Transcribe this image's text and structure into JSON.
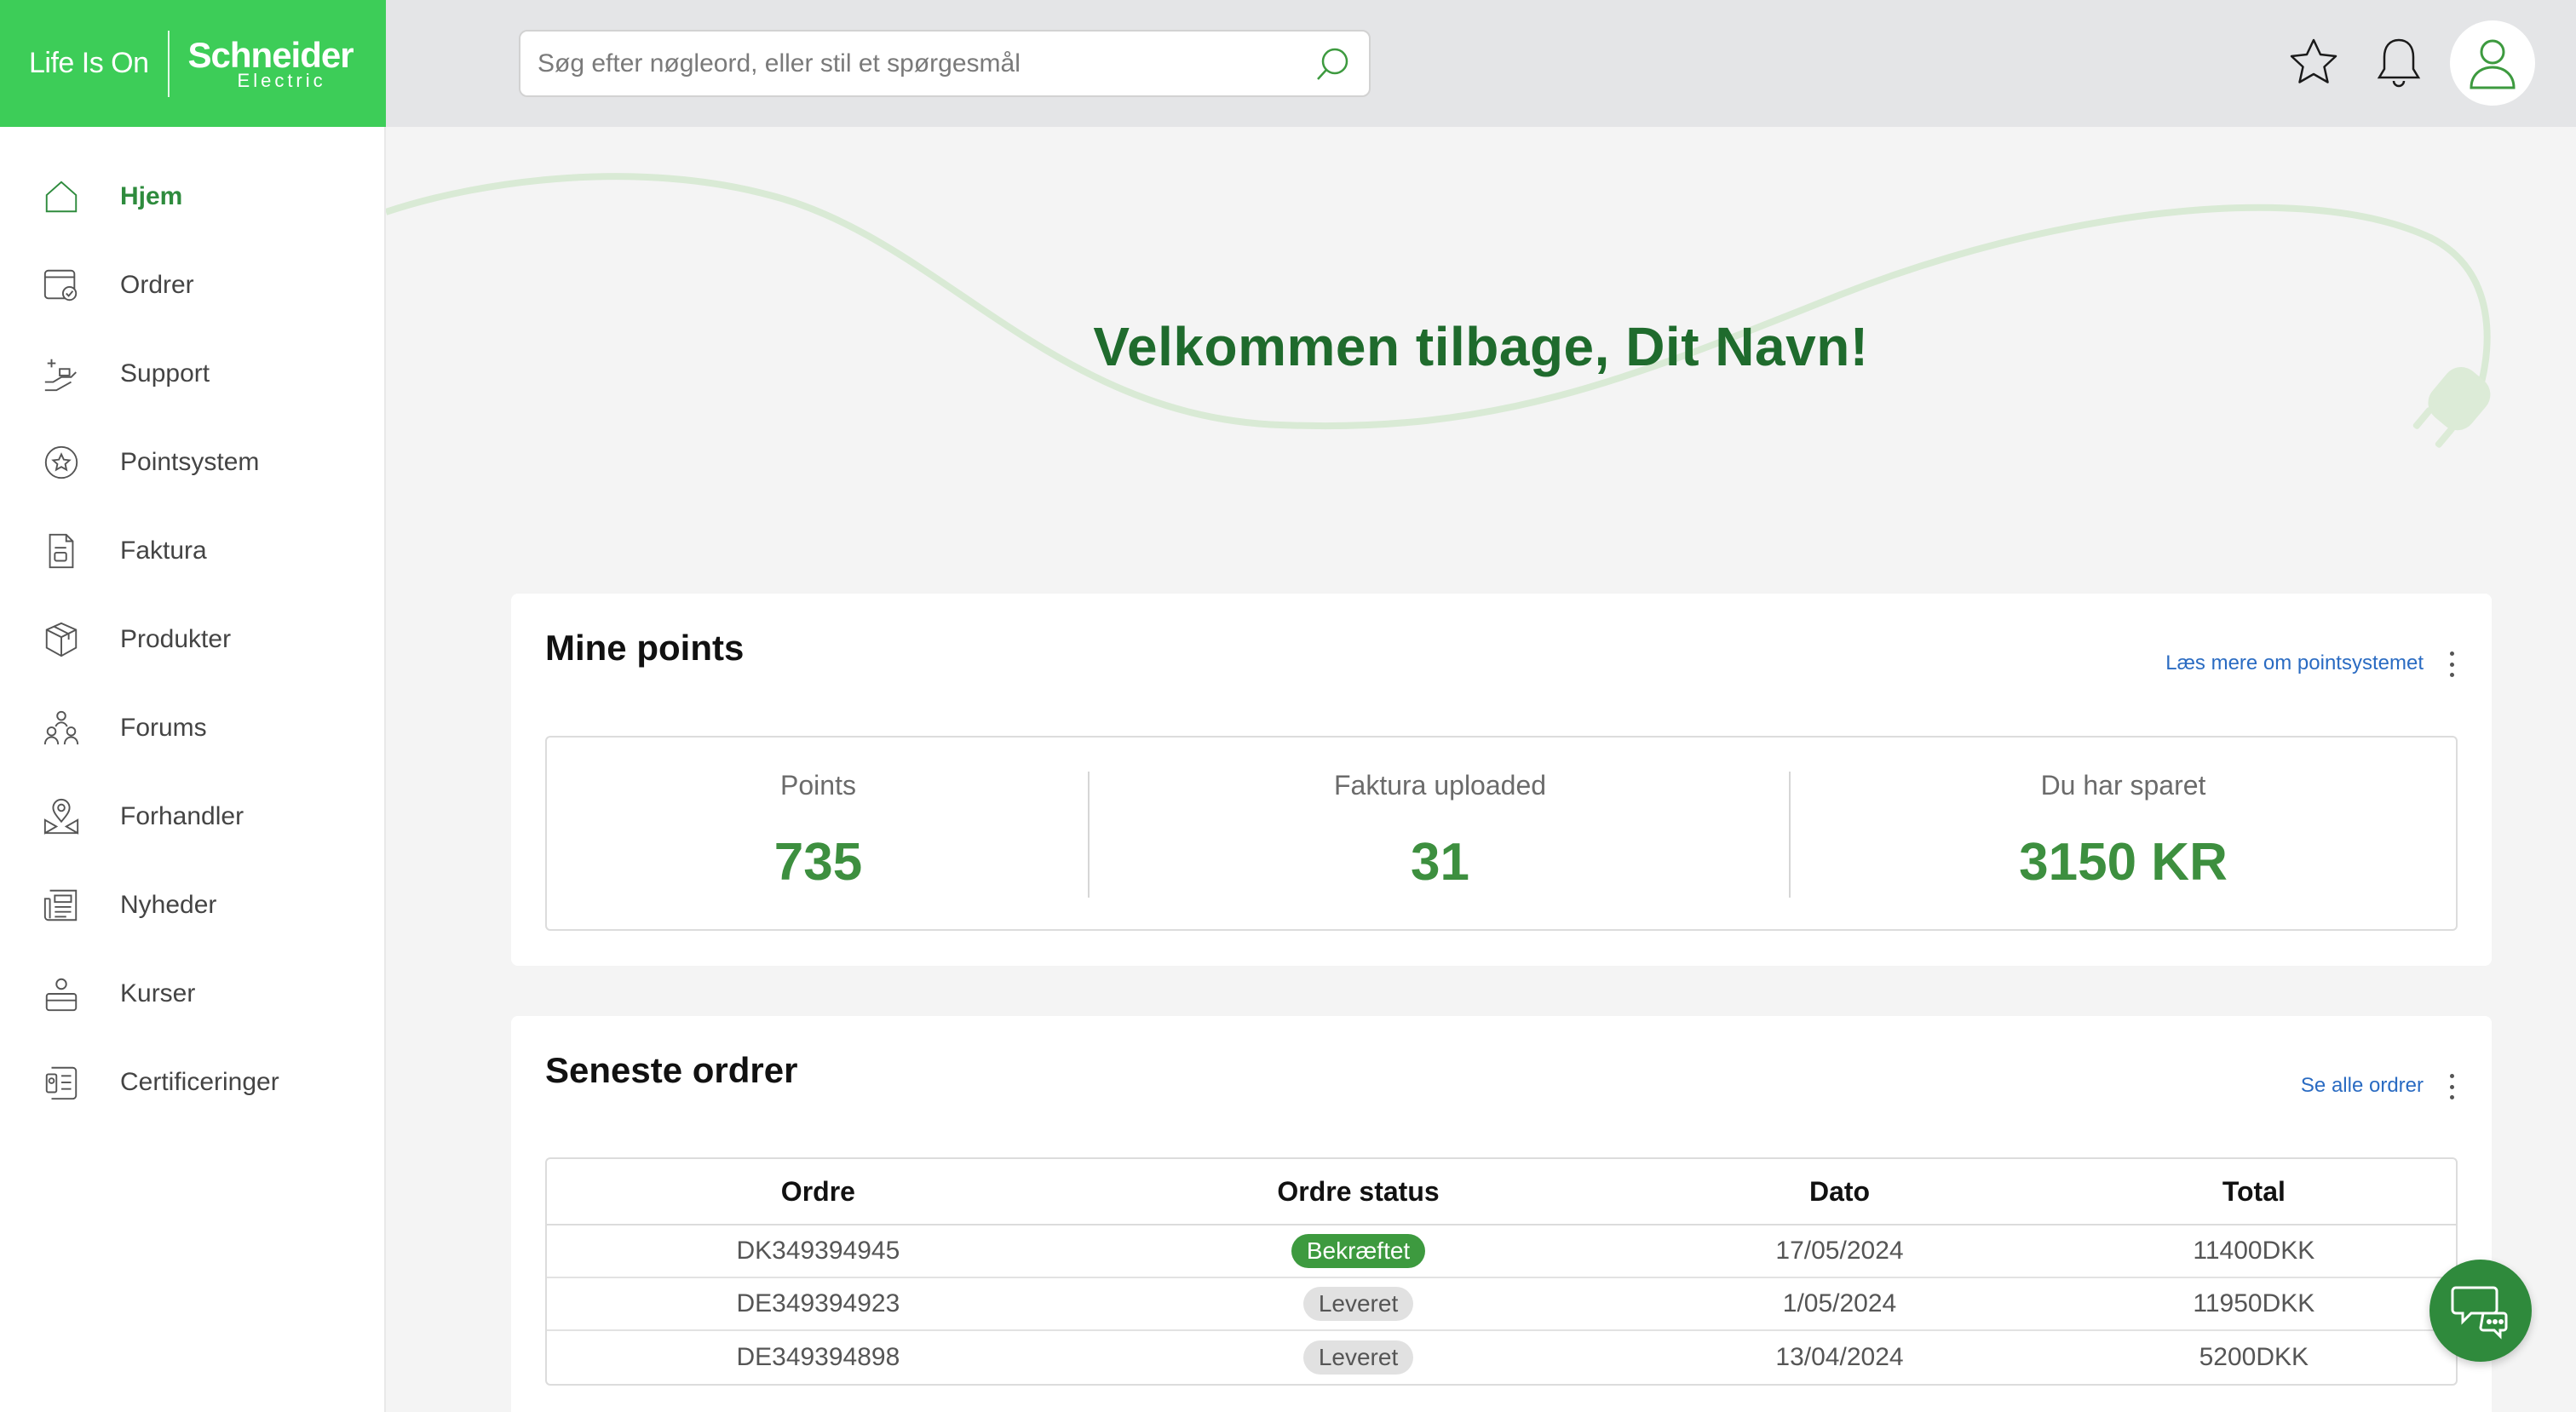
{
  "brand": {
    "tagline": "Life Is On",
    "name": "Schneider",
    "sub": "Electric"
  },
  "colors": {
    "brand_green": "#3dcd58",
    "dark_green": "#1f6b2d",
    "value_green": "#3d8f3f",
    "link_blue": "#2a6bc2"
  },
  "sidebar": {
    "items": [
      {
        "label": "Hjem",
        "icon": "home-icon",
        "active": true
      },
      {
        "label": "Ordrer",
        "icon": "orders-icon"
      },
      {
        "label": "Support",
        "icon": "support-icon"
      },
      {
        "label": "Pointsystem",
        "icon": "points-star-icon"
      },
      {
        "label": "Faktura",
        "icon": "invoice-icon"
      },
      {
        "label": "Produkter",
        "icon": "box-icon"
      },
      {
        "label": "Forums",
        "icon": "forum-people-icon"
      },
      {
        "label": "Forhandler",
        "icon": "dealer-location-icon"
      },
      {
        "label": "Nyheder",
        "icon": "newspaper-icon"
      },
      {
        "label": "Kurser",
        "icon": "course-icon"
      },
      {
        "label": "Certificeringer",
        "icon": "certificate-icon"
      }
    ]
  },
  "header": {
    "search_placeholder": "Søg efter nøgleord, eller stil et spørgesmål",
    "icons": [
      "star-icon",
      "bell-icon",
      "user-icon"
    ]
  },
  "hero": {
    "welcome": "Velkommen tilbage, Dit Navn!"
  },
  "points_card": {
    "title": "Mine points",
    "link": "Læs mere om pointsystemet",
    "stats": [
      {
        "label": "Points",
        "value": "735"
      },
      {
        "label": "Faktura uploaded",
        "value": "31"
      },
      {
        "label": "Du har sparet",
        "value": "3150 KR"
      }
    ]
  },
  "orders_card": {
    "title": "Seneste ordrer",
    "link": "Se alle ordrer",
    "columns": [
      "Ordre",
      "Ordre status",
      "Dato",
      "Total"
    ],
    "rows": [
      {
        "order": "DK349394945",
        "status": "Bekræftet",
        "date": "17/05/2024",
        "total": "11400DKK"
      },
      {
        "order": "DE349394923",
        "status": "Leveret",
        "date": "1/05/2024",
        "total": "11950DKK"
      },
      {
        "order": "DE349394898",
        "status": "Leveret",
        "date": "13/04/2024",
        "total": "5200DKK"
      }
    ]
  },
  "chat": {
    "icon": "chat-support-icon"
  }
}
